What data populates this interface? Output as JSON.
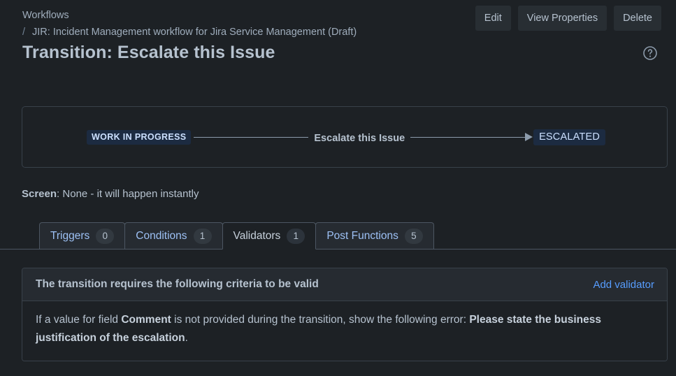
{
  "header": {
    "breadcrumb_root": "Workflows",
    "breadcrumb_separator": "/",
    "breadcrumb_current": "JIR: Incident Management workflow for Jira Service Management (Draft)",
    "page_title": "Transition: Escalate this Issue",
    "actions": {
      "edit": "Edit",
      "view_properties": "View Properties",
      "delete": "Delete"
    },
    "help_icon": "help-circle-icon"
  },
  "diagram": {
    "from_status": "WORK IN PROGRESS",
    "transition_label": "Escalate this Issue",
    "to_status": "ESCALATED"
  },
  "screen": {
    "label": "Screen",
    "separator": ": ",
    "value": "None - it will happen instantly"
  },
  "tabs": [
    {
      "label": "Triggers",
      "count": "0",
      "active": false
    },
    {
      "label": "Conditions",
      "count": "1",
      "active": false
    },
    {
      "label": "Validators",
      "count": "1",
      "active": true
    },
    {
      "label": "Post Functions",
      "count": "5",
      "active": false
    }
  ],
  "panel": {
    "title": "The transition requires the following criteria to be valid",
    "add_link": "Add validator",
    "body": {
      "part1": "If a value for field ",
      "field": "Comment",
      "part2": " is not provided during the transition, show the following error: ",
      "error": "Please state the business justification of the escalation",
      "part3": "."
    }
  },
  "colors": {
    "page_background": "#1d2125",
    "accent_link": "#579dff",
    "lozenge_background": "#1c2b41",
    "lozenge_text": "#cce0ff",
    "text_primary": "#b6c2cf",
    "text_subtle": "#9fadbc",
    "border": "#39414a"
  }
}
